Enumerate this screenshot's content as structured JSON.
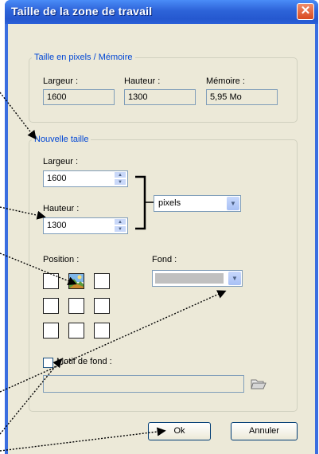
{
  "window": {
    "title": "Taille de la zone de travail",
    "close_glyph": "✕"
  },
  "memory_group": {
    "legend": "Taille en pixels / Mémoire",
    "width_label": "Largeur :",
    "width_value": "1600",
    "height_label": "Hauteur :",
    "height_value": "1300",
    "memory_label": "Mémoire :",
    "memory_value": "5,95 Mo"
  },
  "new_size_group": {
    "legend": "Nouvelle taille",
    "width_label": "Largeur :",
    "width_value": "1600",
    "height_label": "Hauteur :",
    "height_value": "1300",
    "unit_value": "pixels",
    "position_label": "Position :",
    "background_label": "Fond :",
    "background_color": "#c0c0c0",
    "pattern_label": "Motif de fond :",
    "pattern_checked": false,
    "pattern_path": ""
  },
  "buttons": {
    "ok": "Ok",
    "cancel": "Annuler"
  },
  "icons": {
    "spin_up": "▲",
    "spin_down": "▼",
    "dropdown": "▼"
  }
}
